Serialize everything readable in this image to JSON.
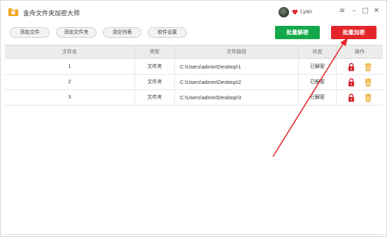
{
  "app": {
    "title": "金舟文件夹加密大师",
    "user_name": "Lyan"
  },
  "window_controls": {
    "menu": "≡",
    "minimize": "–",
    "maximize": "□",
    "close": "✕"
  },
  "toolbar": {
    "add_file": "添加文件",
    "add_folder": "添加文件夹",
    "clear_list": "清空列表",
    "settings": "软件设置",
    "batch_decrypt": "批量解密",
    "batch_encrypt": "批量加密"
  },
  "table": {
    "headers": [
      "文件名",
      "类型",
      "文件路径",
      "状态",
      "操作"
    ],
    "rows": [
      {
        "name": "1",
        "type": "文件夹",
        "path": "C:\\Users\\admin\\Desktop\\1",
        "status": "已解密"
      },
      {
        "name": "2",
        "type": "文件夹",
        "path": "C:\\Users\\admin\\Desktop\\2",
        "status": "已解密"
      },
      {
        "name": "3",
        "type": "文件夹",
        "path": "C:\\Users\\admin\\Desktop\\3",
        "status": "已解密"
      }
    ]
  },
  "colors": {
    "decrypt_button": "#13a84a",
    "encrypt_button": "#e3262a",
    "lock_icon": "#d3202a",
    "trash_icon": "#e8a317",
    "annotation_arrow": "#e3262a"
  },
  "icons": {
    "app": "folder-lock-icon",
    "vip": "vip-heart-icon",
    "row_lock": "lock-icon",
    "row_delete": "trash-icon"
  }
}
